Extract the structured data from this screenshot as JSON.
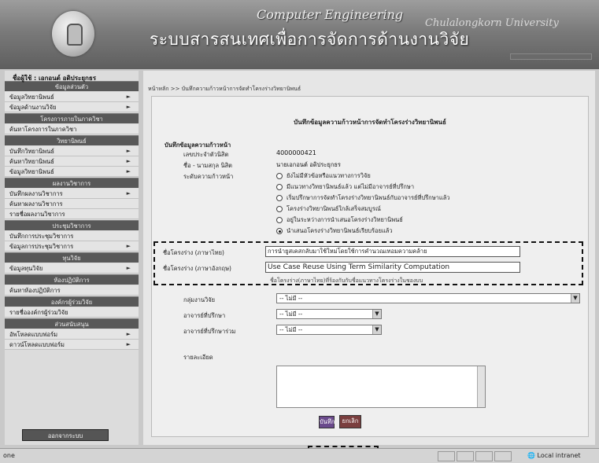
{
  "header": {
    "brand_en": "Computer Engineering",
    "brand_en2": "Chulalongkorn University",
    "system_title": "ระบบสารสนเทศเพื่อการจัดการด้านงานวิจัย"
  },
  "sidebar": {
    "user_line": "ชื่อผู้ใช้ : เอกอนต์ อดิประยุกธร",
    "logout_label": "ออกจากระบบ",
    "sections": [
      {
        "header": "ข้อมูลส่วนตัว",
        "items": [
          {
            "label": "ข้อมูลวิทยานิพนธ์",
            "arrow": "►"
          },
          {
            "label": "ข้อมูลด้านงานวิจัย",
            "arrow": "►"
          }
        ]
      },
      {
        "header": "โครงการภายในภาควิชา",
        "items": [
          {
            "label": "ค้นหาโครงการในภาควิชา",
            "arrow": ""
          }
        ]
      },
      {
        "header": "วิทยานิพนธ์",
        "items": [
          {
            "label": "บันทึกวิทยานิพนธ์",
            "arrow": "►"
          },
          {
            "label": "ค้นหาวิทยานิพนธ์",
            "arrow": "►"
          },
          {
            "label": "ข้อมูลวิทยานิพนธ์",
            "arrow": "►"
          }
        ]
      },
      {
        "header": "ผลงานวิชาการ",
        "items": [
          {
            "label": "บันทึกผลงานวิชาการ",
            "arrow": "►"
          },
          {
            "label": "ค้นหาผลงานวิชาการ",
            "arrow": ""
          },
          {
            "label": "รายชื่อผลงานวิชาการ",
            "arrow": ""
          }
        ]
      },
      {
        "header": "ประชุมวิชาการ",
        "items": [
          {
            "label": "บันทึกการประชุมวิชาการ",
            "arrow": ""
          },
          {
            "label": "ข้อมูลการประชุมวิชาการ",
            "arrow": "►"
          }
        ]
      },
      {
        "header": "ทุนวิจัย",
        "items": [
          {
            "label": "ข้อมูลทุนวิจัย",
            "arrow": "►"
          }
        ]
      },
      {
        "header": "ห้องปฏิบัติการ",
        "items": [
          {
            "label": "ค้นหาห้องปฏิบัติการ",
            "arrow": ""
          }
        ]
      },
      {
        "header": "องค์กรผู้ร่วมวิจัย",
        "items": [
          {
            "label": "รายชื่อองค์กรผู้ร่วมวิจัย",
            "arrow": ""
          }
        ]
      },
      {
        "header": "ส่วนสนับสนุน",
        "items": [
          {
            "label": "อัพโหลดแบบฟอร์ม",
            "arrow": "►"
          },
          {
            "label": "ดาวน์โหลดแบบฟอร์ม",
            "arrow": "►"
          }
        ]
      }
    ]
  },
  "main": {
    "breadcrumb": "หน้าหลัก >> บันทึกความก้าวหน้าการจัดทำโครงร่างวิทยานิพนธ์",
    "form_title": "บันทึกข้อมูลความก้าวหน้าการจัดทำโครงร่างวิทยานิพนธ์",
    "section_label": "บันทึกข้อมูลความก้าวหน้า",
    "student_id_label": "เลขประจำตัวนิสิต",
    "student_id": "4000000421",
    "student_name_label": "ชื่อ - นามสกุล นิสิต",
    "student_name": "นายเอกอนต์ อดิประยุกธร",
    "progress_label": "ระดับความก้าวหน้า",
    "progress_options": [
      {
        "label": "ยังไม่มีหัวข้อหรือแนวทางการวิจัย",
        "selected": false
      },
      {
        "label": "มีแนวทางวิทยานิพนธ์แล้ว แต่ไม่มีอาจารย์ที่ปรึกษา",
        "selected": false
      },
      {
        "label": "เริ่มปรึกษาการจัดทำโครงร่างวิทยานิพนธ์กับอาจารย์ที่ปรึกษาแล้ว",
        "selected": false
      },
      {
        "label": "โครงร่างวิทยานิพนธ์ใกล้เสร็จสมบูรณ์",
        "selected": false
      },
      {
        "label": "อยู่ในระหว่างการนำเสนอโครงร่างวิทยานิพนธ์",
        "selected": false
      },
      {
        "label": "นำเสนอโครงร่างวิทยานิพนธ์เรียบร้อยแล้ว",
        "selected": true
      }
    ],
    "title_th_label": "ชื่อโครงร่าง (ภาษาไทย)",
    "title_th_value": "การนำยูสเคสกลับมาใช้ใหม่โดยใช้การคำนวณเทอมความคล้าย",
    "title_en_label": "ชื่อโครงร่าง (ภาษาอังกฤษ)",
    "title_en_value": "Use Case Reuse Using Term Similarity Computation",
    "title_hint": "ชื่อโครงร่าง(ภาษาไทย)ที่ร้องกับกับชื่อแนวทางโครงร่างในชองบบ",
    "research_group_label": "กลุ่มงานวิจัย",
    "research_group_value": "-- ไม่มี --",
    "advisor_label": "อาจารย์ที่ปรึกษา",
    "advisor_value": "-- ไม่มี --",
    "coadvisor_label": "อาจารย์ที่ปรึกษาร่วม",
    "coadvisor_value": "-- ไม่มี --",
    "detail_label": "รายละเอียด",
    "save_label": "บันทึก",
    "cancel_label": "ยกเลิก"
  },
  "statusbar": {
    "left_text": "one",
    "zone_text": "Local intranet"
  },
  "colors": {
    "save_button": "#6a4a8c",
    "cancel_button": "#7a3e3e"
  }
}
